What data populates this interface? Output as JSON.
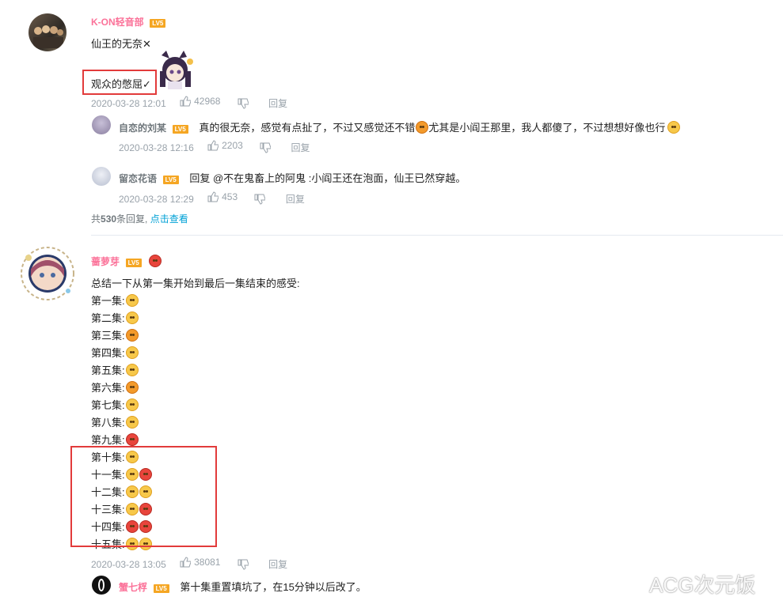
{
  "colors": {
    "username": "#fb7299",
    "meta": "#99a2aa",
    "link": "#00a1d6",
    "highlight": "#e23b3b",
    "level_badge": "#f5a623"
  },
  "comment1": {
    "user": "K-ON轻音部",
    "level": "LV5",
    "line1": "仙王的无奈✕",
    "line2": "观众的憋屈✓",
    "time": "2020-03-28 12:01",
    "likes": "42968",
    "reply_label": "回复",
    "replies": [
      {
        "user": "自恋的刘某",
        "level": "LV5",
        "text1": "真的很无奈，感觉有点扯了，不过又感觉还不错",
        "text2": "尤其是小阎王那里，我人都傻了，不过想想好像也行",
        "time": "2020-03-28 12:16",
        "likes": "2203",
        "reply_label": "回复"
      },
      {
        "user": "留恋花语",
        "level": "LV5",
        "text": "回复 @不在鬼畜上的阿鬼 :小阎王还在泡面，仙王已然穿越。",
        "time": "2020-03-28 12:29",
        "likes": "453",
        "reply_label": "回复"
      }
    ],
    "more_prefix": "共",
    "more_count": "530",
    "more_suffix": "条回复,",
    "more_link": "点击查看"
  },
  "comment2": {
    "user": "蔷萝芽",
    "level": "LV5",
    "intro": "总结一下从第一集开始到最后一集结束的感受:",
    "episodes": [
      {
        "label": "第一集:",
        "emoji": [
          "shocked-emoji"
        ]
      },
      {
        "label": "第二集:",
        "emoji": [
          "surprised-emoji"
        ]
      },
      {
        "label": "第三集:",
        "emoji": [
          "scared-emoji"
        ]
      },
      {
        "label": "第四集:",
        "emoji": [
          "anxious-emoji"
        ]
      },
      {
        "label": "第五集:",
        "emoji": [
          "grin-emoji"
        ]
      },
      {
        "label": "第六集:",
        "emoji": [
          "smirk-emoji"
        ]
      },
      {
        "label": "第七集:",
        "emoji": [
          "covering-mouth-emoji"
        ]
      },
      {
        "label": "第八集:",
        "emoji": [
          "smile-emoji"
        ]
      },
      {
        "label": "第九集:",
        "emoji": [
          "cry-emoji"
        ]
      },
      {
        "label": "第十集:",
        "emoji": [
          "dizzy-emoji"
        ]
      },
      {
        "label": "十一集:",
        "emoji": [
          "rolling-eyes-emoji",
          "angry-emoji"
        ]
      },
      {
        "label": "十二集:",
        "emoji": [
          "dizzy-emoji",
          "dizzy-emoji"
        ]
      },
      {
        "label": "十三集:",
        "emoji": [
          "shocked-emoji",
          "angry-emoji"
        ]
      },
      {
        "label": "十四集:",
        "emoji": [
          "angry-emoji",
          "angry-emoji"
        ]
      },
      {
        "label": "十五集:",
        "emoji": [
          "tongue-emoji",
          "tongue-emoji"
        ]
      }
    ],
    "time": "2020-03-28 13:05",
    "likes": "38081",
    "reply_label": "回复",
    "reply": {
      "user": "蟹七桴",
      "level": "LV5",
      "text": "第十集重置填坑了，在15分钟以后改了。"
    }
  },
  "watermark": "ACG次元饭"
}
